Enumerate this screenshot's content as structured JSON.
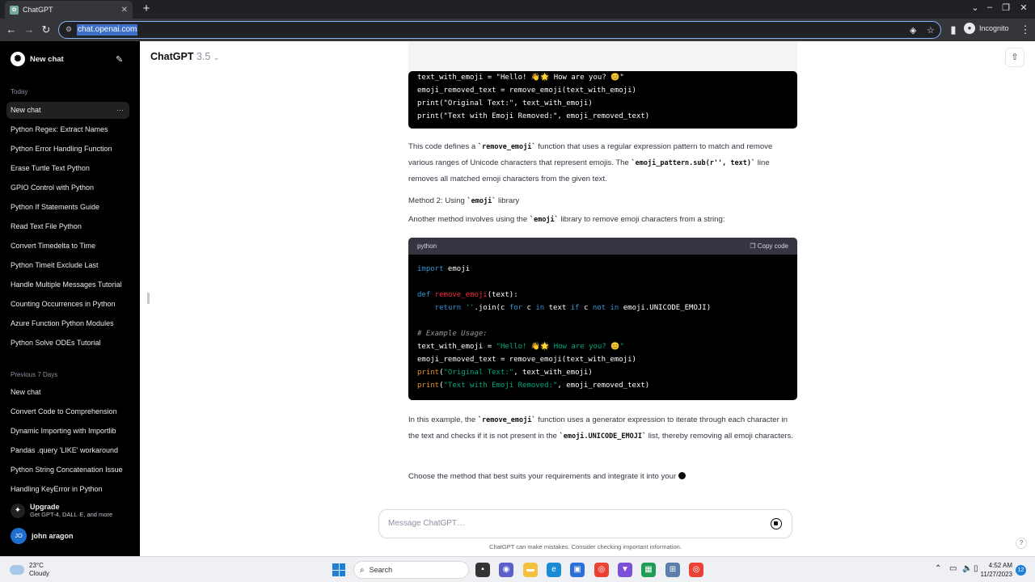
{
  "browser": {
    "tab_title": "ChatGPT",
    "url": "chat.openai.com",
    "incognito_label": "Incognito"
  },
  "sidebar": {
    "new_chat_label": "New chat",
    "today_label": "Today",
    "today_items": [
      "New chat",
      "Python Regex: Extract Names",
      "Python Error Handling Function",
      "Erase Turtle Text Python",
      "GPIO Control with Python",
      "Python If Statements Guide",
      "Read Text File Python",
      "Convert Timedelta to Time",
      "Python Timeit Exclude Last",
      "Handle Multiple Messages Tutorial",
      "Counting Occurrences in Python",
      "Azure Function Python Modules",
      "Python Solve ODEs Tutorial"
    ],
    "prev7_label": "Previous 7 Days",
    "prev7_items": [
      "New chat",
      "Convert Code to Comprehension",
      "Dynamic Importing with Importlib",
      "Pandas .query 'LIKE' workaround",
      "Python String Concatenation Issue",
      "Handling KeyError in Python"
    ],
    "upgrade_title": "Upgrade",
    "upgrade_sub": "Get GPT-4, DALL·E, and more",
    "user_initials": "JO",
    "user_name": "john aragon"
  },
  "header": {
    "model_name": "ChatGPT",
    "model_version": "3.5"
  },
  "content": {
    "code1_lines": [
      "text_with_emoji = \"Hello! 👋🌟 How are you? 😊\"",
      "emoji_removed_text = remove_emoji(text_with_emoji)",
      "print(\"Original Text:\", text_with_emoji)",
      "print(\"Text with Emoji Removed:\", emoji_removed_text)"
    ],
    "para1_a": "This code defines a ",
    "para1_code1": "`remove_emoji`",
    "para1_b": " function that uses a regular expression pattern to match and remove various ranges of Unicode characters that represent emojis. The ",
    "para1_code2": "`emoji_pattern.sub(r'', text)`",
    "para1_c": " line removes all matched emoji characters from the given text.",
    "method2_a": "Method 2: Using ",
    "method2_code": "`emoji`",
    "method2_b": " library",
    "para2_a": "Another method involves using the ",
    "para2_code": "`emoji`",
    "para2_b": " library to remove emoji characters from a string:",
    "code2_lang": "python",
    "code2_copy": "Copy code",
    "para3_a": "In this example, the ",
    "para3_code1": "`remove_emoji`",
    "para3_b": " function uses a generator expression to iterate through each character in the text and checks if it is not present in the ",
    "para3_code2": "`emoji.UNICODE_EMOJI`",
    "para3_c": " list, thereby removing all emoji characters.",
    "para4": "Choose the method that best suits your requirements and integrate it into your"
  },
  "composer": {
    "placeholder": "Message ChatGPT…",
    "disclaimer": "ChatGPT can make mistakes. Consider checking important information."
  },
  "taskbar": {
    "temp": "23°C",
    "condition": "Cloudy",
    "search_label": "Search",
    "time": "4:52 AM",
    "date": "11/27/2023",
    "notifications": "12"
  }
}
